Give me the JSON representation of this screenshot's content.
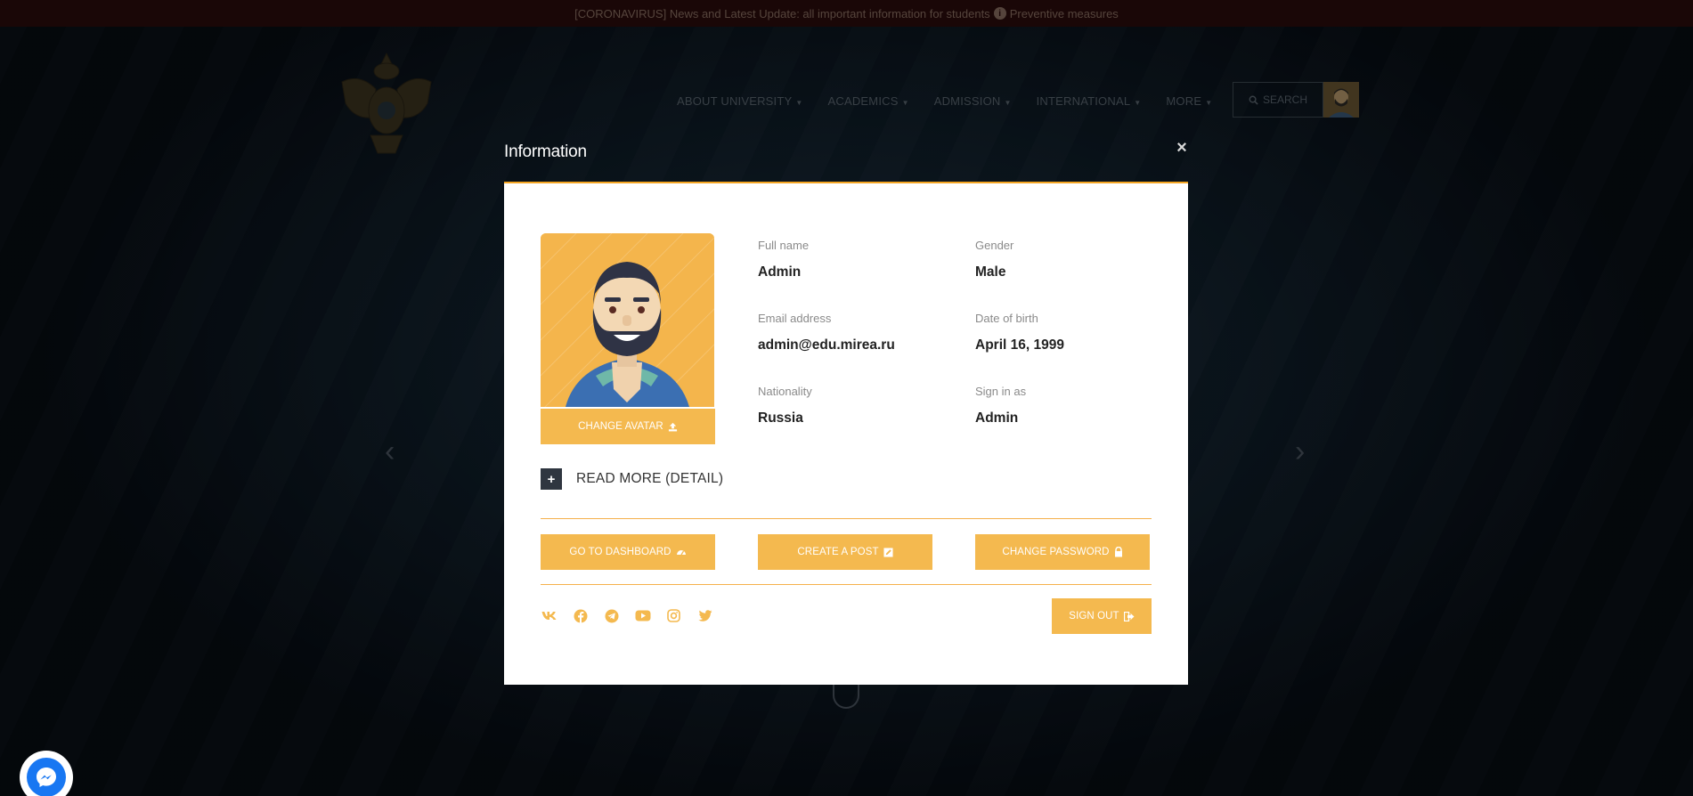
{
  "announcement": {
    "text_before": "[CORONAVIRUS] News and Latest Update: all important information for students",
    "info_icon": "i",
    "text_after": "Preventive measures"
  },
  "nav": {
    "items": [
      "ABOUT UNIVERSITY",
      "ACADEMICS",
      "ADMISSION",
      "INTERNATIONAL",
      "MORE"
    ],
    "search_label": "SEARCH"
  },
  "modal": {
    "title": "Information",
    "close_glyph": "×",
    "change_avatar_label": "CHANGE AVATAR",
    "fields": {
      "full_name_label": "Full name",
      "full_name": "Admin",
      "gender_label": "Gender",
      "gender": "Male",
      "email_label": "Email address",
      "email": "admin@edu.mirea.ru",
      "dob_label": "Date of birth",
      "dob": "April 16, 1999",
      "nationality_label": "Nationality",
      "nationality": "Russia",
      "role_label": "Sign in as",
      "role": "Admin"
    },
    "read_more_icon": "+",
    "read_more_label": "READ MORE (DETAIL)",
    "actions": {
      "dashboard": "GO TO DASHBOARD",
      "create_post": "CREATE A POST",
      "change_password": "CHANGE PASSWORD"
    },
    "socials": [
      "vk-icon",
      "facebook-icon",
      "telegram-icon",
      "youtube-icon",
      "instagram-icon",
      "twitter-icon"
    ],
    "sign_out": "SIGN OUT"
  },
  "colors": {
    "accent": "#f4b94f",
    "accent_line": "#f5a623",
    "messenger": "#1877f2"
  }
}
